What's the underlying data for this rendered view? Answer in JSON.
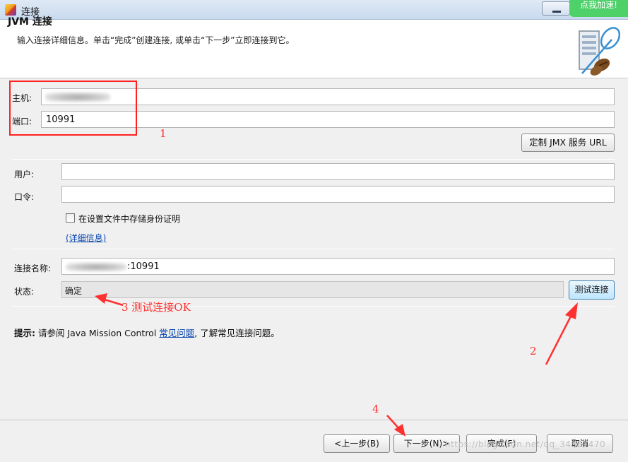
{
  "window": {
    "title": "连接",
    "speed_badge": "点我加速!"
  },
  "header": {
    "title": "JVM 连接",
    "description": "输入连接详细信息。单击“完成”创建连接, 或单击“下一步”立即连接到它。"
  },
  "connection": {
    "host_label": "主机:",
    "host_value": "",
    "port_label": "端口:",
    "port_value": "10991",
    "custom_jmx_button": "定制 JMX 服务 URL"
  },
  "credentials": {
    "user_label": "用户:",
    "user_value": "",
    "password_label": "口令:",
    "password_value": "",
    "store_checkbox_label": "在设置文件中存储身份证明",
    "store_checked": false,
    "details_link": "(详细信息)"
  },
  "status_section": {
    "name_label": "连接名称:",
    "name_value_suffix": ":10991",
    "status_label": "状态:",
    "status_value": "确定",
    "test_button": "测试连接"
  },
  "hint": {
    "bold": "提示:",
    "text_before": " 请参阅 Java Mission Control ",
    "link": "常见问题",
    "text_after": ", 了解常见连接问题。"
  },
  "footer": {
    "back_button": "<上一步(B)",
    "next_button": "下一步(N)>",
    "finish_button": "完成(F)",
    "cancel_button": "取消",
    "watermark": "https://blog.csdn.net/qq_34387470"
  },
  "annotations": {
    "n1": "1",
    "n2": "2",
    "n3": "3 测试连接OK",
    "n4": "4",
    "color": "#ff3030"
  }
}
